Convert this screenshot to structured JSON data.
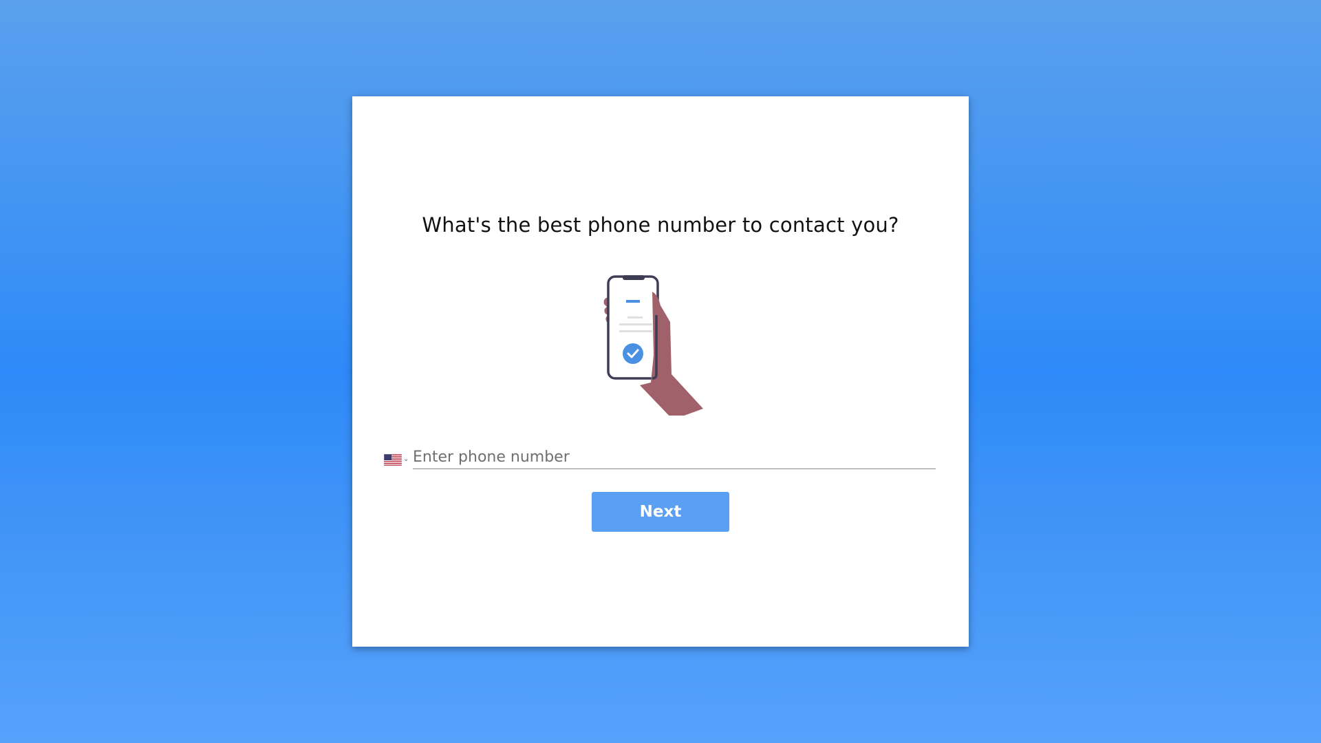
{
  "form": {
    "question": "What's the best phone number to contact you?",
    "illustration_icon": "hand-holding-phone-check-icon",
    "country": {
      "flag_icon": "us-flag-icon",
      "chevron_icon": "chevron-down-icon"
    },
    "phone_input": {
      "placeholder": "Enter phone number",
      "value": ""
    },
    "next_label": "Next"
  },
  "colors": {
    "background_top": "#5aa0ee",
    "background_mid": "#2e8af8",
    "card": "#ffffff",
    "button": "#5a9ff2",
    "accent": "#4a90e2",
    "skin": "#a0616a",
    "phone_outline": "#3f3d56"
  }
}
